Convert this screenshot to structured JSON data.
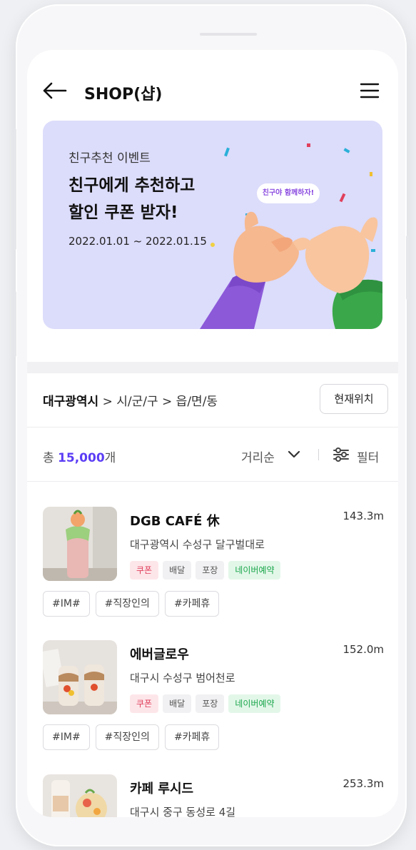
{
  "header": {
    "title": "SHOP(샵)",
    "back_icon": "arrow-left-icon",
    "menu_icon": "hamburger-menu-icon"
  },
  "banner": {
    "subtitle": "친구추천 이벤트",
    "title": "친구에게 추천하고\n할인 쿠폰 받자!",
    "date": "2022.01.01 ~ 2022.01.15",
    "bubble": "친구야 함께하자!",
    "background": "#dcdcfb"
  },
  "location": {
    "bold": "대구광역시",
    "rest": " > 시/군/구 > 읍/면/동",
    "button": "현재위치"
  },
  "summary": {
    "prefix": "총 ",
    "count": "15,000",
    "suffix": "개",
    "sort_label": "거리순",
    "filter_label": "필터",
    "accent": "#5b3df5"
  },
  "shops": [
    {
      "name": "DGB CAFÉ 休",
      "distance": "143.3m",
      "address": "대구광역시 수성구 달구벌대로",
      "badges": [
        "쿠폰",
        "배달",
        "포장",
        "네이버예약"
      ],
      "tags": [
        "#IM#",
        "#직장인의",
        "#카페휴"
      ]
    },
    {
      "name": "에버글로우",
      "distance": "152.0m",
      "address": "대구시 수성구 범어천로",
      "badges": [
        "쿠폰",
        "배달",
        "포장",
        "네이버예약"
      ],
      "tags": [
        "#IM#",
        "#직장인의",
        "#카페휴"
      ]
    },
    {
      "name": "카페 루시드",
      "distance": "253.3m",
      "address": "대구시 중구 동성로 4길"
    }
  ]
}
